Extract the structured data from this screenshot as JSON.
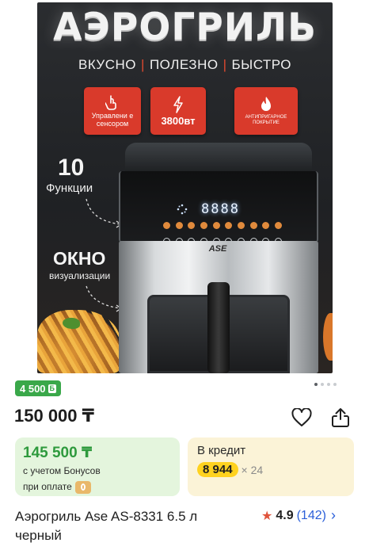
{
  "hero": {
    "title": "АЭРОГРИЛЬ",
    "tagline": [
      "ВКУСНО",
      "ПОЛЕЗНО",
      "БЫСТРО"
    ],
    "tagline_separator": "|",
    "badges": [
      {
        "icon": "touch-hand-icon",
        "text": "Управлени е сенсором"
      },
      {
        "icon": "lightning-icon",
        "text": "3800вт"
      },
      {
        "icon": "flame-icon",
        "text": "АНТИПРИГАРНОЕ ПОКРЫТИЕ"
      }
    ],
    "feature_count": "10",
    "feature_label": "Функции",
    "window_title": "ОКНО",
    "window_label": "визуализации",
    "display_readout": "8888",
    "brand": "ASE"
  },
  "carousel": {
    "count": 4,
    "active": 0
  },
  "bonus_tag": {
    "amount": "4 500",
    "symbol": "Б"
  },
  "price": {
    "main": "150 000 ₸"
  },
  "actions": {
    "favorite_icon": "heart-icon",
    "share_icon": "share-icon"
  },
  "bonus_card": {
    "price": "145 500 ₸",
    "line1": "с учетом Бонусов",
    "line2": "при оплате"
  },
  "credit_card": {
    "title": "В кредит",
    "amount": "8 944",
    "term": "× 24"
  },
  "product": {
    "title": "Аэрогриль Ase AS-8331 6.5 л черный",
    "rating": "4.9",
    "reviews": "(142)"
  },
  "colors": {
    "bonus_green": "#3aa84a",
    "credit_yellow": "#ffd21f",
    "link_blue": "#2b5fd9",
    "star_red": "#e0533b",
    "badge_red": "#d93a2b"
  }
}
